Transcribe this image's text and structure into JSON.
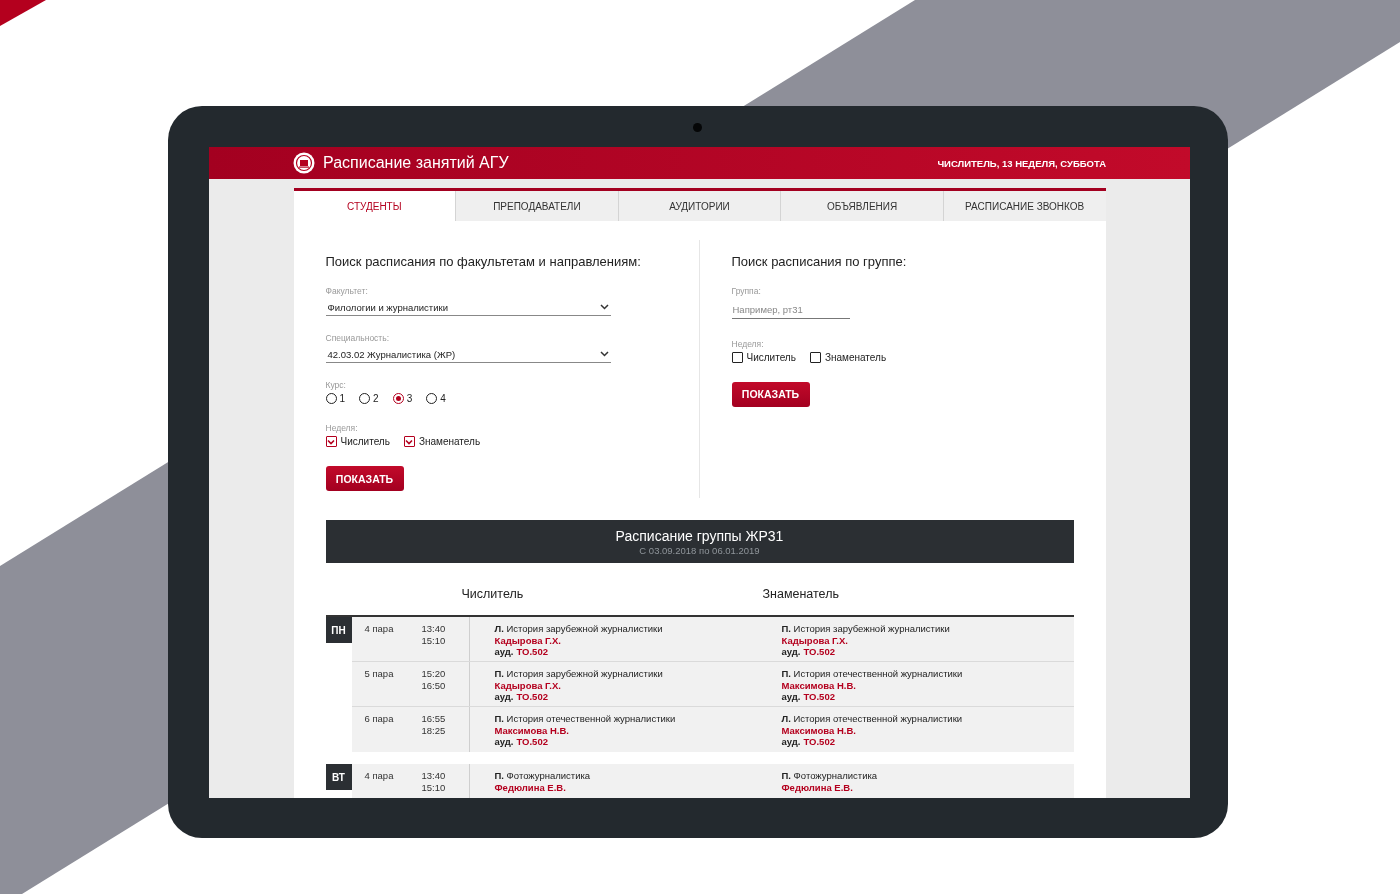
{
  "header": {
    "title": "Расписание занятий АГУ",
    "week_info": "ЧИСЛИТЕЛЬ, 13 НЕДЕЛЯ, СУББОТА"
  },
  "tabs": [
    {
      "label": "СТУДЕНТЫ",
      "selected": true
    },
    {
      "label": "ПРЕПОДАВАТЕЛИ",
      "selected": false
    },
    {
      "label": "АУДИТОРИИ",
      "selected": false
    },
    {
      "label": "ОБЪЯВЛЕНИЯ",
      "selected": false
    },
    {
      "label": "РАСПИСАНИЕ ЗВОНКОВ",
      "selected": false
    }
  ],
  "faculty_search": {
    "heading": "Поиск расписания по факультетам и направлениям:",
    "selects": [
      {
        "label": "Факультет:",
        "value": "Филологии и журналистики"
      },
      {
        "label": "Специальность:",
        "value": "42.03.02 Журналистика (ЖР)"
      }
    ],
    "course": {
      "label": "Курс:",
      "options": [
        {
          "label": "1",
          "selected": false
        },
        {
          "label": "2",
          "selected": false
        },
        {
          "label": "3",
          "selected": true
        },
        {
          "label": "4",
          "selected": false
        }
      ]
    },
    "week": {
      "label": "Неделя:",
      "options": [
        {
          "label": "Числитель",
          "checked": true
        },
        {
          "label": "Знаменатель",
          "checked": true
        }
      ]
    },
    "button": "ПОКАЗАТЬ"
  },
  "group_search": {
    "heading": "Поиск расписания по группе:",
    "group": {
      "label": "Группа:",
      "placeholder": "Например, рт31"
    },
    "week": {
      "label": "Неделя:",
      "options": [
        {
          "label": "Числитель",
          "checked": false
        },
        {
          "label": "Знаменатель",
          "checked": false
        }
      ]
    },
    "button": "ПОКАЗАТЬ"
  },
  "schedule": {
    "title": "Расписание группы ЖР31",
    "period": "С 03.09.2018 по 06.01.2019",
    "columns": [
      "Числитель",
      "Знаменатель"
    ],
    "days": [
      {
        "day": "ПН",
        "lessons": [
          {
            "pair": "4 пара",
            "start": "13:40",
            "end": "15:10",
            "entries": [
              {
                "subject": "**Л.** История зарубежной журналистики",
                "teacher": "Кадырова Г.Х.",
                "room_label": "ауд.",
                "room": "ТО.502"
              },
              {
                "subject": "**П.** История зарубежной журналистики",
                "teacher": "Кадырова Г.Х.",
                "room_label": "ауд.",
                "room": "ТО.502"
              }
            ]
          },
          {
            "pair": "5 пара",
            "start": "15:20",
            "end": "16:50",
            "entries": [
              {
                "subject": "**П.** История зарубежной журналистики",
                "teacher": "Кадырова Г.Х.",
                "room_label": "ауд.",
                "room": "ТО.502"
              },
              {
                "subject": "**П.** История отечественной журналистики",
                "teacher": "Максимова Н.В.",
                "room_label": "ауд.",
                "room": "ТО.502"
              }
            ]
          },
          {
            "pair": "6 пара",
            "start": "16:55",
            "end": "18:25",
            "entries": [
              {
                "subject": "**П.** История отечественной журналистики",
                "teacher": "Максимова Н.В.",
                "room_label": "ауд.",
                "room": "ТО.502"
              },
              {
                "subject": "**Л.** История отечественной журналистики",
                "teacher": "Максимова Н.В.",
                "room_label": "ауд.",
                "room": "ТО.502"
              }
            ]
          }
        ]
      },
      {
        "day": "ВТ",
        "lessons": [
          {
            "pair": "4 пара",
            "start": "13:40",
            "end": "15:10",
            "entries": [
              {
                "subject": "**П.** Фотожурналистика",
                "teacher": "Федюлина Е.В."
              },
              {
                "subject": "**П.** Фотожурналистика",
                "teacher": "Федюлина Е.В."
              }
            ]
          }
        ]
      }
    ]
  }
}
